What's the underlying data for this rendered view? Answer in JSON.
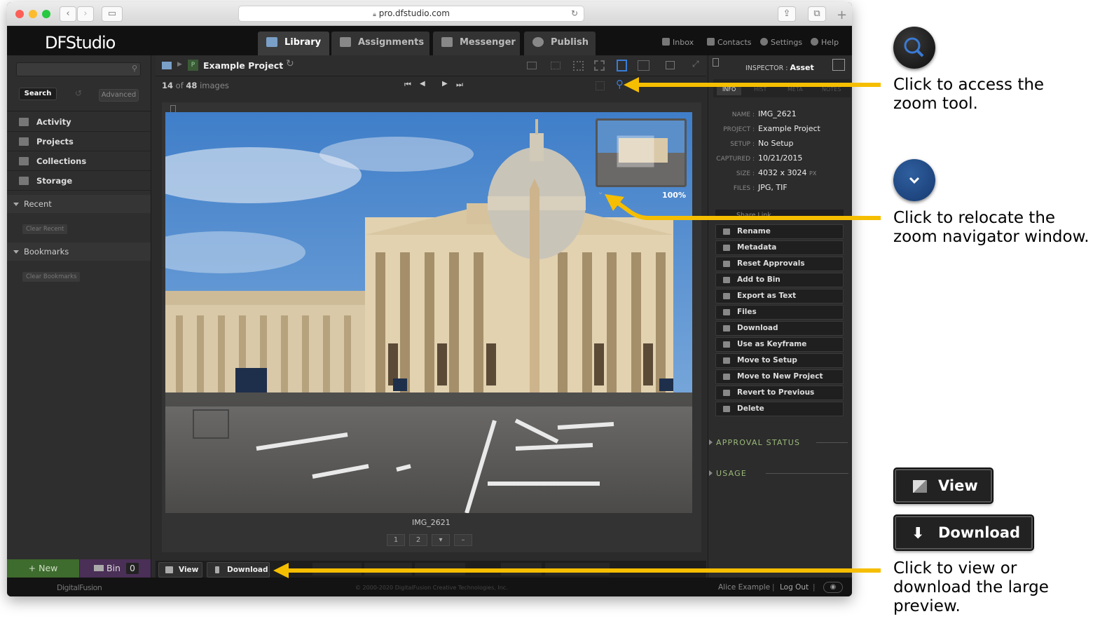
{
  "browser": {
    "url": "pro.dfstudio.com"
  },
  "app": {
    "logo": "DFStudio",
    "tabs": [
      {
        "label": "Library",
        "active": true
      },
      {
        "label": "Assignments",
        "active": false
      },
      {
        "label": "Messenger",
        "active": false
      },
      {
        "label": "Publish",
        "active": false
      }
    ],
    "top_links": [
      "Inbox",
      "Contacts",
      "Settings",
      "Help"
    ]
  },
  "sidebar": {
    "search_button": "Search",
    "advanced_button": "Advanced",
    "nav": [
      "Activity",
      "Projects",
      "Collections",
      "Storage"
    ],
    "recent": {
      "label": "Recent",
      "clear": "Clear Recent"
    },
    "bookmarks": {
      "label": "Bookmarks",
      "clear": "Clear Bookmarks"
    },
    "new_button": "+ New",
    "bin": {
      "label": "Bin",
      "count": "0"
    }
  },
  "main": {
    "badge": "P",
    "project_title": "Example Project",
    "counter": {
      "current": "14",
      "of": "of",
      "total": "48",
      "unit": "images"
    },
    "zoom_percent": "100%",
    "image_name": "IMG_2621",
    "page_buttons": [
      "1",
      "2",
      "",
      "–"
    ],
    "view_button": "View",
    "download_button": "Download"
  },
  "inspector": {
    "header_prefix": "INSPECTOR :",
    "header_value": "Asset",
    "tabs": [
      "INFO",
      "HIST",
      "META",
      "NOTES"
    ],
    "fields": [
      {
        "key": "NAME :",
        "value": "IMG_2621"
      },
      {
        "key": "PROJECT :",
        "value": "Example Project"
      },
      {
        "key": "SETUP :",
        "value": "No Setup"
      },
      {
        "key": "CAPTURED :",
        "value": "10/21/2015"
      },
      {
        "key": "SIZE :",
        "value": "4032 x 3024",
        "unit": "PX"
      },
      {
        "key": "FILES :",
        "value": "JPG, TIF"
      }
    ],
    "share_link": "Share Link",
    "actions": [
      "Rename",
      "Metadata",
      "Reset Approvals",
      "Add to Bin",
      "Export as Text",
      "Files",
      "Download",
      "Use as Keyframe",
      "Move to Setup",
      "Move to New Project",
      "Revert to Previous",
      "Delete"
    ],
    "sections": [
      "APPROVAL STATUS",
      "USAGE"
    ]
  },
  "footer": {
    "brand": "DigitalFusion",
    "copyright": "© 2000-2020 DigitalFusion Creative Technologies, Inc.",
    "user": "Alice Example",
    "logout": "Log Out"
  },
  "annotations": {
    "zoom_tool": [
      "Click to access the",
      "zoom tool."
    ],
    "navigator": [
      "Click to relocate the",
      "zoom navigator window."
    ],
    "view_download": [
      "Click to view or",
      "download the large",
      "preview."
    ],
    "view_label": "View",
    "download_label": "Download"
  },
  "colors": {
    "arrow": "#f6be00",
    "accent_blue": "#3a7bd5",
    "approval_green": "#9cba7a",
    "new_green": "#3e6b2e",
    "bin_purple": "#4a2f57"
  }
}
